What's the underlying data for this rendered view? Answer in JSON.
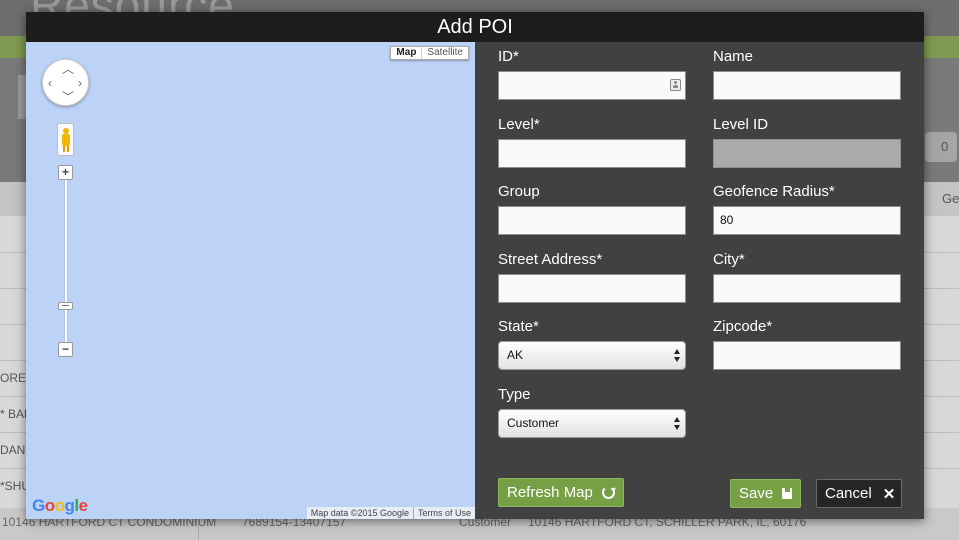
{
  "background": {
    "logo_fragment": "Resource",
    "right_select_text": "0",
    "column_fragment": "Ged",
    "left_rows": [
      "ORE*",
      "* BAR",
      "DANI",
      "*SHU"
    ],
    "bottom_row": {
      "name": "10146 HARTFORD CT CONDOMINIUM",
      "id": "7689154-13407157",
      "type": "Customer",
      "address": "10146 HARTFORD CT, SCHILLER PARK, IL, 60176"
    }
  },
  "modal": {
    "title": "Add POI",
    "map": {
      "type_map": "Map",
      "type_satellite": "Satellite",
      "zoom_in": "+",
      "zoom_out": "−",
      "logo": "Google",
      "attribution": "Map data ©2015 Google",
      "terms": "Terms of Use",
      "background_color": "#bcd3f7"
    },
    "form": {
      "id": {
        "label": "ID*",
        "value": ""
      },
      "name": {
        "label": "Name",
        "value": ""
      },
      "level": {
        "label": "Level*",
        "value": ""
      },
      "level_id": {
        "label": "Level ID",
        "value": ""
      },
      "group": {
        "label": "Group",
        "value": ""
      },
      "geofence_radius": {
        "label": "Geofence Radius*",
        "value": "80"
      },
      "street_address": {
        "label": "Street Address*",
        "value": ""
      },
      "city": {
        "label": "City*",
        "value": ""
      },
      "state": {
        "label": "State*",
        "value": "AK"
      },
      "zipcode": {
        "label": "Zipcode*",
        "value": ""
      },
      "type": {
        "label": "Type",
        "value": "Customer"
      }
    },
    "buttons": {
      "refresh_map": "Refresh Map",
      "save": "Save",
      "cancel": "Cancel"
    },
    "colors": {
      "accent_green": "#76a043",
      "modal_bg": "#414141",
      "title_bar": "#1d1d1d"
    }
  }
}
